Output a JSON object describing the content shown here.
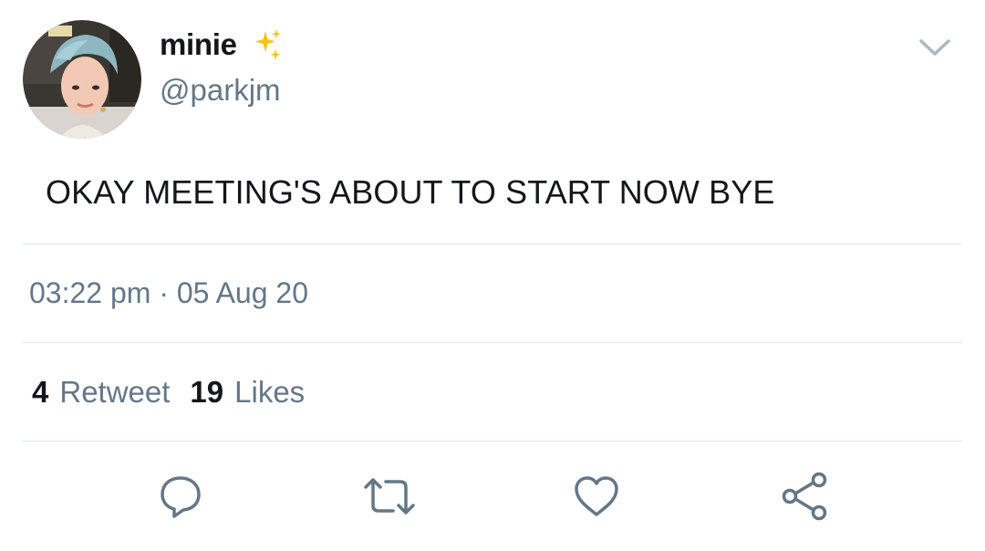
{
  "user": {
    "display_name": "minie",
    "handle": "@parkjm",
    "emoji_icon": "sparkles-icon",
    "avatar_icon": "profile-photo"
  },
  "tweet": {
    "text": "OKAY MEETING'S ABOUT TO START NOW BYE",
    "time": "03:22 pm",
    "separator": "·",
    "date": "05 Aug 20"
  },
  "stats": {
    "retweet_count": "4",
    "retweet_label": "Retweet",
    "like_count": "19",
    "like_label": "Likes"
  },
  "actions": {
    "reply_icon": "reply-icon",
    "retweet_icon": "retweet-icon",
    "like_icon": "heart-icon",
    "share_icon": "share-icon"
  },
  "colors": {
    "text_primary": "#14171a",
    "text_secondary": "#657786",
    "divider": "#e1e8ed",
    "icon": "#657786",
    "sparkle": "#f5c518"
  }
}
